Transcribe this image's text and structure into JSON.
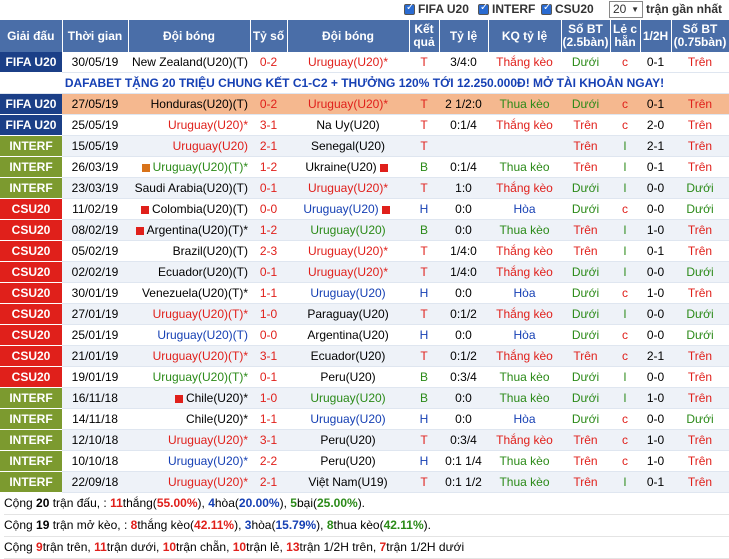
{
  "filters": {
    "items": [
      {
        "label": "FIFA U20",
        "checked": true
      },
      {
        "label": "INTERF",
        "checked": true
      },
      {
        "label": "CSU20",
        "checked": true
      }
    ],
    "count_value": "20",
    "count_suffix": "trận gần nhất"
  },
  "headers": [
    "Giải đấu",
    "Thời gian",
    "Đội bóng",
    "Tỷ số",
    "Đội bóng",
    "Kết quả",
    "Tỷ lệ",
    "KQ tỷ lệ",
    "Số BT (2.5bàn)",
    "Lẻ c hẵn",
    "1/2H",
    "Số BT (0.75bàn)"
  ],
  "league_colors": {
    "FIFA U20": "#1b3f87",
    "INTERF": "#7c9a2f",
    "CSU20": "#e0201b"
  },
  "promo": "DAFABET TẶNG 20 TRIỆU CHUNG KẾT C1-C2 + THƯỞNG 120% TỚI 12.250.000Đ! MỞ TÀI KHOẢN NGAY!",
  "rows": [
    {
      "league": "FIFA U20",
      "date": "30/05/19",
      "home": "New Zealand(U20)(T)",
      "hc": "",
      "hflag": "",
      "score": "0-2",
      "away": "Uruguay(U20)*",
      "ac": "red",
      "aflag": "",
      "res": "T",
      "odds": "3/4:0",
      "kq": "Thắng kèo",
      "bt25": "Dưới",
      "lc": "c",
      "h1": "0-1",
      "bt075": "Trên"
    },
    {
      "promo": true
    },
    {
      "league": "FIFA U20",
      "date": "27/05/19",
      "home": "Honduras(U20)(T)",
      "hc": "",
      "hflag": "",
      "score": "0-2",
      "away": "Uruguay(U20)*",
      "ac": "red",
      "aflag": "",
      "res": "T",
      "odds": "2 1/2:0",
      "kq": "Thua kèo",
      "bt25": "Dưới",
      "lc": "c",
      "h1": "0-1",
      "bt075": "Trên",
      "hl": true
    },
    {
      "league": "FIFA U20",
      "date": "25/05/19",
      "home": "Uruguay(U20)*",
      "hc": "red",
      "hflag": "",
      "score": "3-1",
      "away": "Na Uy(U20)",
      "ac": "",
      "aflag": "",
      "res": "T",
      "odds": "0:1/4",
      "kq": "Thắng kèo",
      "bt25": "Trên",
      "lc": "c",
      "h1": "2-0",
      "bt075": "Trên"
    },
    {
      "league": "INTERF",
      "date": "15/05/19",
      "home": "Uruguay(U20)",
      "hc": "red",
      "hflag": "",
      "score": "2-1",
      "away": "Senegal(U20)",
      "ac": "",
      "aflag": "",
      "res": "T",
      "odds": "",
      "kq": "",
      "bt25": "Trên",
      "lc": "l",
      "h1": "2-1",
      "bt075": "Trên"
    },
    {
      "league": "INTERF",
      "date": "26/03/19",
      "home": "Uruguay(U20)(T)*",
      "hc": "green",
      "hflag": "o",
      "score": "1-2",
      "away": "Ukraine(U20)",
      "ac": "",
      "aflag": "r",
      "res": "B",
      "odds": "0:1/4",
      "kq": "Thua kèo",
      "bt25": "Trên",
      "lc": "l",
      "h1": "0-1",
      "bt075": "Trên"
    },
    {
      "league": "INTERF",
      "date": "23/03/19",
      "home": "Saudi Arabia(U20)(T)",
      "hc": "",
      "hflag": "",
      "score": "0-1",
      "away": "Uruguay(U20)*",
      "ac": "red",
      "aflag": "",
      "res": "T",
      "odds": "1:0",
      "kq": "Thắng kèo",
      "bt25": "Dưới",
      "lc": "l",
      "h1": "0-0",
      "bt075": "Dưới"
    },
    {
      "league": "CSU20",
      "date": "11/02/19",
      "home": "Colombia(U20)(T)",
      "hc": "",
      "hflag": "r",
      "score": "0-0",
      "away": "Uruguay(U20)",
      "ac": "blue",
      "aflag": "r",
      "res": "H",
      "odds": "0:0",
      "kq": "Hòa",
      "bt25": "Dưới",
      "lc": "c",
      "h1": "0-0",
      "bt075": "Dưới"
    },
    {
      "league": "CSU20",
      "date": "08/02/19",
      "home": "Argentina(U20)(T)*",
      "hc": "",
      "hflag": "r",
      "score": "1-2",
      "away": "Uruguay(U20)",
      "ac": "green",
      "aflag": "",
      "res": "B",
      "odds": "0:0",
      "kq": "Thua kèo",
      "bt25": "Trên",
      "lc": "l",
      "h1": "1-0",
      "bt075": "Trên"
    },
    {
      "league": "CSU20",
      "date": "05/02/19",
      "home": "Brazil(U20)(T)",
      "hc": "",
      "hflag": "",
      "score": "2-3",
      "away": "Uruguay(U20)*",
      "ac": "red",
      "aflag": "",
      "res": "T",
      "odds": "1/4:0",
      "kq": "Thắng kèo",
      "bt25": "Trên",
      "lc": "l",
      "h1": "0-1",
      "bt075": "Trên"
    },
    {
      "league": "CSU20",
      "date": "02/02/19",
      "home": "Ecuador(U20)(T)",
      "hc": "",
      "hflag": "",
      "score": "0-1",
      "away": "Uruguay(U20)*",
      "ac": "red",
      "aflag": "",
      "res": "T",
      "odds": "1/4:0",
      "kq": "Thắng kèo",
      "bt25": "Dưới",
      "lc": "l",
      "h1": "0-0",
      "bt075": "Dưới"
    },
    {
      "league": "CSU20",
      "date": "30/01/19",
      "home": "Venezuela(U20)(T)*",
      "hc": "",
      "hflag": "",
      "score": "1-1",
      "away": "Uruguay(U20)",
      "ac": "blue",
      "aflag": "",
      "res": "H",
      "odds": "0:0",
      "kq": "Hòa",
      "bt25": "Dưới",
      "lc": "c",
      "h1": "1-0",
      "bt075": "Trên"
    },
    {
      "league": "CSU20",
      "date": "27/01/19",
      "home": "Uruguay(U20)(T)*",
      "hc": "red",
      "hflag": "",
      "score": "1-0",
      "away": "Paraguay(U20)",
      "ac": "",
      "aflag": "",
      "res": "T",
      "odds": "0:1/2",
      "kq": "Thắng kèo",
      "bt25": "Dưới",
      "lc": "l",
      "h1": "0-0",
      "bt075": "Dưới"
    },
    {
      "league": "CSU20",
      "date": "25/01/19",
      "home": "Uruguay(U20)(T)",
      "hc": "blue",
      "hflag": "",
      "score": "0-0",
      "away": "Argentina(U20)",
      "ac": "",
      "aflag": "",
      "res": "H",
      "odds": "0:0",
      "kq": "Hòa",
      "bt25": "Dưới",
      "lc": "c",
      "h1": "0-0",
      "bt075": "Dưới"
    },
    {
      "league": "CSU20",
      "date": "21/01/19",
      "home": "Uruguay(U20)(T)*",
      "hc": "red",
      "hflag": "",
      "score": "3-1",
      "away": "Ecuador(U20)",
      "ac": "",
      "aflag": "",
      "res": "T",
      "odds": "0:1/2",
      "kq": "Thắng kèo",
      "bt25": "Trên",
      "lc": "c",
      "h1": "2-1",
      "bt075": "Trên"
    },
    {
      "league": "CSU20",
      "date": "19/01/19",
      "home": "Uruguay(U20)(T)*",
      "hc": "green",
      "hflag": "",
      "score": "0-1",
      "away": "Peru(U20)",
      "ac": "",
      "aflag": "",
      "res": "B",
      "odds": "0:3/4",
      "kq": "Thua kèo",
      "bt25": "Dưới",
      "lc": "l",
      "h1": "0-0",
      "bt075": "Trên"
    },
    {
      "league": "INTERF",
      "date": "16/11/18",
      "home": "Chile(U20)*",
      "hc": "",
      "hflag": "r",
      "score": "1-0",
      "away": "Uruguay(U20)",
      "ac": "green",
      "aflag": "",
      "res": "B",
      "odds": "0:0",
      "kq": "Thua kèo",
      "bt25": "Dưới",
      "lc": "l",
      "h1": "1-0",
      "bt075": "Trên"
    },
    {
      "league": "INTERF",
      "date": "14/11/18",
      "home": "Chile(U20)*",
      "hc": "",
      "hflag": "",
      "score": "1-1",
      "away": "Uruguay(U20)",
      "ac": "blue",
      "aflag": "",
      "res": "H",
      "odds": "0:0",
      "kq": "Hòa",
      "bt25": "Dưới",
      "lc": "c",
      "h1": "0-0",
      "bt075": "Dưới"
    },
    {
      "league": "INTERF",
      "date": "12/10/18",
      "home": "Uruguay(U20)*",
      "hc": "red",
      "hflag": "",
      "score": "3-1",
      "away": "Peru(U20)",
      "ac": "",
      "aflag": "",
      "res": "T",
      "odds": "0:3/4",
      "kq": "Thắng kèo",
      "bt25": "Trên",
      "lc": "c",
      "h1": "1-0",
      "bt075": "Trên"
    },
    {
      "league": "INTERF",
      "date": "10/10/18",
      "home": "Uruguay(U20)*",
      "hc": "blue",
      "hflag": "",
      "score": "2-2",
      "away": "Peru(U20)",
      "ac": "",
      "aflag": "",
      "res": "H",
      "odds": "0:1 1/4",
      "kq": "Thua kèo",
      "bt25": "Trên",
      "lc": "c",
      "h1": "1-0",
      "bt075": "Trên"
    },
    {
      "league": "INTERF",
      "date": "22/09/18",
      "home": "Uruguay(U20)*",
      "hc": "red",
      "hflag": "",
      "score": "2-1",
      "away": "Việt Nam(U19)",
      "ac": "",
      "aflag": "",
      "res": "T",
      "odds": "0:1 1/2",
      "kq": "Thua kèo",
      "bt25": "Trên",
      "lc": "l",
      "h1": "0-1",
      "bt075": "Trên"
    }
  ],
  "summary": {
    "line1": [
      {
        "t": "Cộng "
      },
      {
        "t": "20",
        "b": true
      },
      {
        "t": " trận đấu, : "
      },
      {
        "t": "11",
        "c": "red",
        "b": true
      },
      {
        "t": "thắng("
      },
      {
        "t": "55.00%",
        "c": "red",
        "b": true
      },
      {
        "t": "), "
      },
      {
        "t": "4",
        "c": "blue",
        "b": true
      },
      {
        "t": "hòa("
      },
      {
        "t": "20.00%",
        "c": "blue",
        "b": true
      },
      {
        "t": "), "
      },
      {
        "t": "5",
        "c": "green",
        "b": true
      },
      {
        "t": "bại("
      },
      {
        "t": "25.00%",
        "c": "green",
        "b": true
      },
      {
        "t": ")."
      }
    ],
    "line2": [
      {
        "t": "Cộng "
      },
      {
        "t": "19",
        "b": true
      },
      {
        "t": " trận mở kèo, : "
      },
      {
        "t": "8",
        "c": "red",
        "b": true
      },
      {
        "t": "thắng kèo("
      },
      {
        "t": "42.11%",
        "c": "red",
        "b": true
      },
      {
        "t": "), "
      },
      {
        "t": "3",
        "c": "blue",
        "b": true
      },
      {
        "t": "hòa("
      },
      {
        "t": "15.79%",
        "c": "blue",
        "b": true
      },
      {
        "t": "), "
      },
      {
        "t": "8",
        "c": "green",
        "b": true
      },
      {
        "t": "thua kèo("
      },
      {
        "t": "42.11%",
        "c": "green",
        "b": true
      },
      {
        "t": ")."
      }
    ],
    "line3": [
      {
        "t": "Cộng "
      },
      {
        "t": "9",
        "c": "red",
        "b": true
      },
      {
        "t": "trận trên, "
      },
      {
        "t": "11",
        "c": "red",
        "b": true
      },
      {
        "t": "trận dưới, "
      },
      {
        "t": "10",
        "c": "red",
        "b": true
      },
      {
        "t": "trận chẵn, "
      },
      {
        "t": "10",
        "c": "red",
        "b": true
      },
      {
        "t": "trận lẻ, "
      },
      {
        "t": "13",
        "c": "red",
        "b": true
      },
      {
        "t": "trận 1/2H trên, "
      },
      {
        "t": "7",
        "c": "red",
        "b": true
      },
      {
        "t": "trận 1/2H dưới"
      }
    ]
  }
}
